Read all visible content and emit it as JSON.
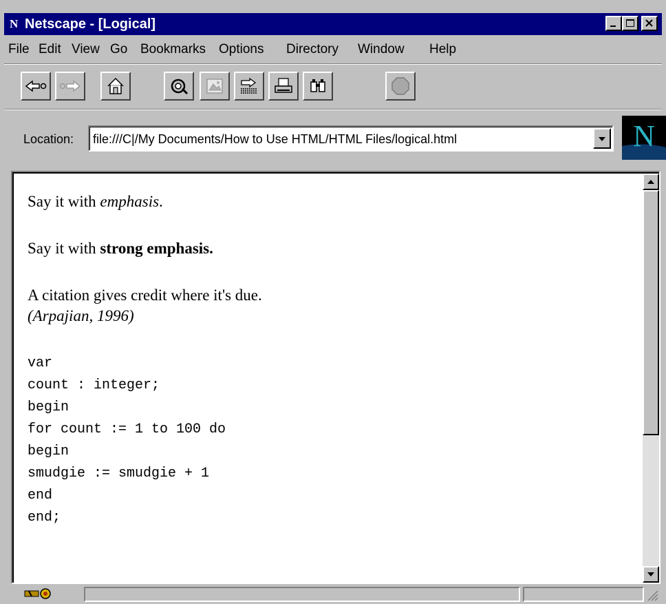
{
  "window": {
    "title": "Netscape - [Logical]",
    "app_icon": "netscape-n-icon"
  },
  "menu": [
    "File",
    "Edit",
    "View",
    "Go",
    "Bookmarks",
    "Options",
    "Directory",
    "Window",
    "Help"
  ],
  "toolbar": {
    "buttons": [
      "back-icon",
      "forward-icon",
      "home-icon",
      "reload-icon",
      "images-icon",
      "open-icon",
      "print-icon",
      "find-icon",
      "stop-icon"
    ]
  },
  "location": {
    "label": "Location:",
    "url": "file:///C|/My Documents/How to Use HTML/HTML Files/logical.html"
  },
  "document": {
    "line1_prefix": "Say it with ",
    "line1_em": "emphasis",
    "line1_suffix": ".",
    "line2_prefix": "Say it with ",
    "line2_strong": "strong emphasis.",
    "line3": "A citation gives credit where it's due.",
    "cite": "(Arpajian, 1996)",
    "code": "var\ncount : integer;\nbegin\nfor count := 1 to 100 do\nbegin\nsmudgie := smudgie + 1\nend\nend;"
  },
  "colors": {
    "titlebar": "#00007c",
    "chrome": "#c0c0c0",
    "page": "#ffffff"
  }
}
